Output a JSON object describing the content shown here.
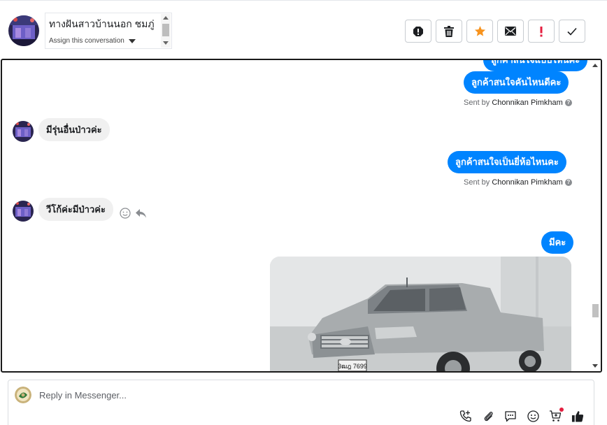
{
  "header": {
    "contact_name": "ทางฝันสาวบ้านนอก ชมภู่",
    "assign_label": "Assign this conversation"
  },
  "actions": [
    {
      "name": "spam-button",
      "icon": "alert-circle-icon"
    },
    {
      "name": "delete-button",
      "icon": "trash-icon"
    },
    {
      "name": "star-button",
      "icon": "star-icon",
      "color": "#f7931e"
    },
    {
      "name": "mark-unread-button",
      "icon": "envelope-icon"
    },
    {
      "name": "follow-up-button",
      "icon": "exclamation-icon",
      "color": "#e41e3f"
    },
    {
      "name": "done-button",
      "icon": "checkmark-icon"
    }
  ],
  "messages": {
    "partial_top": "ลูกค้าสนใจแบบไหนคะ",
    "out_1": "ลูกค้าสนใจคันไหนดีคะ",
    "sent_by_1": {
      "prefix": "Sent by",
      "name": "Chonnikan Pimkham"
    },
    "in_1": "มีรุ่นอื่นป่าวค่ะ",
    "out_2": "ลูกค้าสนใจเป็นยี่ห้อไหนคะ",
    "sent_by_2": {
      "prefix": "Sent by",
      "name": "Chonnikan Pimkham"
    },
    "in_2": "วีโก้ค่ะมีป่าวค่ะ",
    "out_3": "มีคะ",
    "plate": "3ฒฎ 7699"
  },
  "composer": {
    "placeholder": "Reply in Messenger..."
  },
  "colors": {
    "accent": "#0084ff",
    "incoming_bg": "#f0f0f0",
    "alert": "#e41e3f",
    "star": "#f7931e"
  }
}
